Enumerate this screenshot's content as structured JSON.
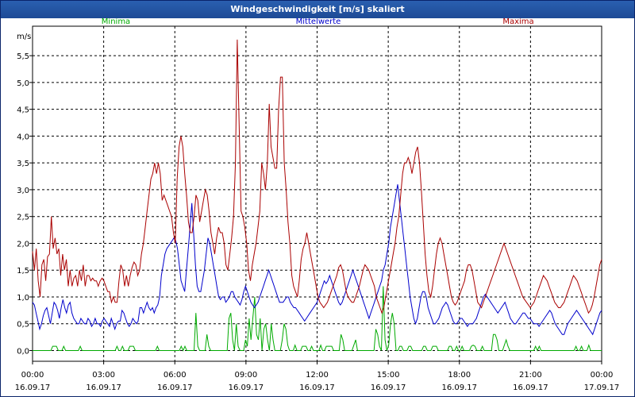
{
  "window": {
    "title": "Windgeschwindigkeit [m/s] skaliert"
  },
  "colors": {
    "minima": "#00aa00",
    "mittelwerte": "#0000cc",
    "maxima": "#aa0000",
    "grid": "#000000"
  },
  "chart_data": {
    "type": "line",
    "title": "Windgeschwindigkeit [m/s] skaliert",
    "ylabel": "m/s",
    "ylim": [
      -0.2,
      6.05
    ],
    "xlim": [
      0,
      24
    ],
    "grid": true,
    "yticks": [
      "0,0",
      "0,5",
      "1,0",
      "1,5",
      "2,0",
      "2,5",
      "3,0",
      "3,5",
      "4,0",
      "4,5",
      "5,0",
      "5,5"
    ],
    "ytick_values": [
      0,
      0.5,
      1,
      1.5,
      2,
      2.5,
      3,
      3.5,
      4,
      4.5,
      5,
      5.5
    ],
    "xticks": [
      {
        "time": "00:00",
        "date": "16.09.17"
      },
      {
        "time": "03:00",
        "date": "16.09.17"
      },
      {
        "time": "06:00",
        "date": "16.09.17"
      },
      {
        "time": "09:00",
        "date": "16.09.17"
      },
      {
        "time": "12:00",
        "date": "16.09.17"
      },
      {
        "time": "15:00",
        "date": "16.09.17"
      },
      {
        "time": "18:00",
        "date": "16.09.17"
      },
      {
        "time": "21:00",
        "date": "16.09.17"
      },
      {
        "time": "00:00",
        "date": "17.09.17"
      }
    ],
    "x_hours_step": 0.1667,
    "series": [
      {
        "name": "Minima",
        "color": "#00aa00",
        "values": [
          0,
          0,
          0,
          0,
          0,
          0,
          0,
          0,
          0,
          0,
          0,
          0.08,
          0.08,
          0.08,
          0,
          0,
          0,
          0.08,
          0,
          0,
          0,
          0,
          0,
          0,
          0,
          0,
          0.08,
          0,
          0,
          0,
          0,
          0,
          0,
          0,
          0,
          0,
          0,
          0,
          0,
          0,
          0,
          0,
          0,
          0,
          0,
          0,
          0.08,
          0,
          0,
          0.08,
          0,
          0,
          0,
          0.08,
          0.08,
          0.08,
          0,
          0,
          0,
          0,
          0,
          0,
          0,
          0,
          0,
          0,
          0,
          0,
          0.08,
          0,
          0,
          0,
          0,
          0,
          0,
          0,
          0,
          0,
          0,
          0,
          0,
          0.08,
          0,
          0.08,
          0,
          0,
          0,
          0,
          0,
          0.7,
          0.08,
          0,
          0,
          0,
          0,
          0.3,
          0.08,
          0,
          0,
          0,
          0,
          0,
          0,
          0,
          0,
          0,
          0,
          0.6,
          0.7,
          0.2,
          0,
          0.5,
          0.08,
          0,
          0,
          0,
          0.2,
          0.08,
          0.6,
          0.2,
          0.6,
          1.0,
          0.3,
          0.2,
          0.6,
          0,
          0.4,
          0.5,
          0.2,
          0,
          0.5,
          0.2,
          0,
          0,
          0,
          0,
          0.2,
          0.5,
          0.4,
          0.1,
          0,
          0,
          0,
          0.1,
          0,
          0,
          0,
          0.08,
          0.08,
          0.08,
          0,
          0,
          0.08,
          0,
          0,
          0,
          0,
          0.1,
          0,
          0,
          0.08,
          0.08,
          0.08,
          0.08,
          0,
          0,
          0,
          0,
          0.3,
          0.2,
          0,
          0,
          0,
          0,
          0,
          0.1,
          0.2,
          0,
          0,
          0,
          0,
          0,
          0,
          0,
          0,
          0,
          0,
          0.4,
          0.3,
          0.08,
          0,
          1.2,
          0.2,
          0,
          0.1,
          0.5,
          0.7,
          0.5,
          0,
          0,
          0.08,
          0.08,
          0,
          0,
          0,
          0.08,
          0.08,
          0,
          0,
          0,
          0,
          0,
          0,
          0.08,
          0.08,
          0,
          0,
          0,
          0.08,
          0.08,
          0.08,
          0,
          0,
          0,
          0,
          0,
          0,
          0.08,
          0.08,
          0,
          0,
          0.08,
          0,
          0,
          0.08,
          0,
          0,
          0,
          0,
          0.08,
          0.1,
          0.08,
          0,
          0,
          0,
          0.08,
          0,
          0,
          0,
          0,
          0,
          0.3,
          0.3,
          0.2,
          0,
          0,
          0,
          0.1,
          0.2,
          0.08,
          0,
          0,
          0,
          0,
          0,
          0,
          0,
          0,
          0,
          0,
          0,
          0,
          0,
          0,
          0.08,
          0,
          0.08,
          0,
          0,
          0,
          0,
          0,
          0,
          0,
          0,
          0,
          0,
          0,
          0,
          0,
          0,
          0,
          0,
          0,
          0,
          0,
          0.08,
          0,
          0,
          0.08,
          0,
          0,
          0,
          0.1,
          0,
          0,
          0,
          0,
          0,
          0,
          0
        ]
      },
      {
        "name": "Mittelwerte",
        "color": "#0000cc",
        "values": [
          0.9,
          0.85,
          0.7,
          0.55,
          0.4,
          0.5,
          0.65,
          0.75,
          0.8,
          0.65,
          0.5,
          0.7,
          0.9,
          0.85,
          0.75,
          0.6,
          0.8,
          0.95,
          0.8,
          0.7,
          0.85,
          0.9,
          0.7,
          0.6,
          0.55,
          0.5,
          0.5,
          0.6,
          0.55,
          0.5,
          0.5,
          0.6,
          0.55,
          0.45,
          0.5,
          0.6,
          0.5,
          0.5,
          0.45,
          0.55,
          0.6,
          0.55,
          0.5,
          0.45,
          0.6,
          0.5,
          0.4,
          0.5,
          0.55,
          0.55,
          0.75,
          0.7,
          0.6,
          0.5,
          0.45,
          0.5,
          0.6,
          0.55,
          0.5,
          0.55,
          0.8,
          0.8,
          0.7,
          0.8,
          0.9,
          0.8,
          0.75,
          0.8,
          0.7,
          0.8,
          0.85,
          1.0,
          1.4,
          1.6,
          1.8,
          1.9,
          1.95,
          2.0,
          2.05,
          2.1,
          2.05,
          1.9,
          1.6,
          1.3,
          1.2,
          1.1,
          1.5,
          1.9,
          2.3,
          2.75,
          2.2,
          1.6,
          1.2,
          1.1,
          1.1,
          1.3,
          1.5,
          1.8,
          2.1,
          2.0,
          1.8,
          1.6,
          1.4,
          1.2,
          1.0,
          0.95,
          1.0,
          1.0,
          0.9,
          0.95,
          1.0,
          1.1,
          1.1,
          1.0,
          0.95,
          0.9,
          0.85,
          0.95,
          1.1,
          1.2,
          1.1,
          1.0,
          0.9,
          0.85,
          0.8,
          0.85,
          0.9,
          1.0,
          1.1,
          1.2,
          1.3,
          1.4,
          1.5,
          1.4,
          1.3,
          1.2,
          1.1,
          1.0,
          0.9,
          0.9,
          0.9,
          0.95,
          1.0,
          1.0,
          0.9,
          0.85,
          0.8,
          0.8,
          0.75,
          0.7,
          0.65,
          0.6,
          0.55,
          0.6,
          0.65,
          0.7,
          0.75,
          0.8,
          0.85,
          0.9,
          1.0,
          1.1,
          1.2,
          1.3,
          1.25,
          1.3,
          1.4,
          1.3,
          1.2,
          1.1,
          1.0,
          0.9,
          0.85,
          0.9,
          1.0,
          1.1,
          1.2,
          1.3,
          1.4,
          1.5,
          1.4,
          1.3,
          1.2,
          1.1,
          1.0,
          0.9,
          0.8,
          0.7,
          0.6,
          0.7,
          0.8,
          0.9,
          1.0,
          1.1,
          1.2,
          1.3,
          1.5,
          1.6,
          1.8,
          2.0,
          2.3,
          2.5,
          2.7,
          2.9,
          3.1,
          2.8,
          2.5,
          2.2,
          1.9,
          1.6,
          1.3,
          1.0,
          0.8,
          0.6,
          0.5,
          0.6,
          0.8,
          1.0,
          1.1,
          1.1,
          1.0,
          0.8,
          0.7,
          0.6,
          0.5,
          0.5,
          0.55,
          0.6,
          0.7,
          0.8,
          0.85,
          0.9,
          0.85,
          0.75,
          0.65,
          0.55,
          0.5,
          0.5,
          0.55,
          0.6,
          0.6,
          0.55,
          0.5,
          0.45,
          0.5,
          0.5,
          0.5,
          0.55,
          0.6,
          0.7,
          0.8,
          0.9,
          1.0,
          1.05,
          1.0,
          0.95,
          0.9,
          0.85,
          0.8,
          0.75,
          0.7,
          0.75,
          0.8,
          0.85,
          0.9,
          0.8,
          0.7,
          0.6,
          0.55,
          0.5,
          0.5,
          0.55,
          0.6,
          0.65,
          0.7,
          0.7,
          0.65,
          0.6,
          0.6,
          0.55,
          0.5,
          0.5,
          0.5,
          0.45,
          0.5,
          0.55,
          0.6,
          0.65,
          0.7,
          0.75,
          0.7,
          0.6,
          0.5,
          0.45,
          0.4,
          0.35,
          0.3,
          0.3,
          0.4,
          0.5,
          0.55,
          0.6,
          0.65,
          0.7,
          0.75,
          0.7,
          0.65,
          0.6,
          0.55,
          0.5,
          0.45,
          0.4,
          0.35,
          0.3,
          0.4,
          0.5,
          0.6,
          0.7,
          0.75
        ]
      },
      {
        "name": "Maxima",
        "color": "#aa0000",
        "values": [
          1.85,
          1.5,
          1.9,
          1.3,
          1.0,
          1.6,
          1.7,
          1.3,
          1.75,
          1.8,
          2.5,
          1.9,
          2.1,
          1.8,
          1.9,
          1.4,
          1.8,
          1.5,
          1.7,
          1.2,
          1.5,
          1.2,
          1.35,
          1.4,
          1.2,
          1.5,
          1.3,
          1.6,
          1.2,
          1.4,
          1.4,
          1.3,
          1.35,
          1.3,
          1.3,
          1.2,
          1.3,
          1.35,
          1.3,
          1.2,
          1.1,
          1.1,
          0.9,
          1.0,
          0.9,
          0.9,
          1.3,
          1.6,
          1.5,
          1.2,
          1.4,
          1.2,
          1.4,
          1.55,
          1.65,
          1.6,
          1.4,
          1.5,
          1.8,
          2.0,
          2.3,
          2.6,
          2.9,
          3.2,
          3.3,
          3.5,
          3.3,
          3.5,
          3.3,
          2.8,
          2.9,
          2.8,
          2.7,
          2.6,
          2.5,
          2.2,
          2.0,
          3.2,
          3.8,
          4.0,
          3.8,
          3.3,
          2.9,
          2.4,
          2.2,
          2.2,
          2.5,
          2.9,
          2.8,
          2.4,
          2.6,
          2.8,
          3.0,
          2.9,
          2.6,
          2.2,
          2.0,
          1.8,
          2.1,
          2.3,
          2.2,
          2.2,
          2.0,
          1.6,
          1.5,
          1.8,
          2.1,
          2.5,
          3.5,
          5.8,
          4.2,
          2.6,
          2.5,
          2.3,
          2.0,
          1.5,
          1.3,
          1.6,
          1.8,
          2.0,
          2.3,
          2.6,
          3.5,
          3.3,
          3.0,
          3.5,
          4.6,
          3.8,
          3.6,
          3.4,
          3.4,
          4.5,
          5.1,
          5.1,
          3.5,
          3.0,
          2.4,
          2.0,
          1.4,
          1.2,
          1.1,
          1.0,
          1.3,
          1.7,
          1.9,
          2.0,
          2.2,
          2.0,
          1.8,
          1.6,
          1.4,
          1.2,
          1.0,
          0.9,
          0.85,
          0.8,
          0.85,
          0.9,
          1.0,
          1.1,
          1.2,
          1.3,
          1.4,
          1.55,
          1.6,
          1.5,
          1.3,
          1.1,
          1.0,
          0.95,
          0.9,
          0.9,
          1.0,
          1.1,
          1.2,
          1.35,
          1.5,
          1.6,
          1.55,
          1.5,
          1.4,
          1.3,
          1.2,
          1.0,
          0.9,
          0.8,
          0.7,
          0.8,
          1.0,
          1.2,
          1.4,
          1.6,
          1.8,
          2.0,
          2.3,
          2.5,
          2.9,
          3.3,
          3.5,
          3.5,
          3.6,
          3.5,
          3.3,
          3.5,
          3.7,
          3.8,
          3.5,
          3.0,
          2.4,
          1.8,
          1.4,
          1.1,
          1.0,
          1.2,
          1.5,
          1.8,
          2.0,
          2.1,
          2.0,
          1.8,
          1.6,
          1.4,
          1.2,
          1.0,
          0.9,
          0.85,
          0.9,
          1.0,
          1.1,
          1.2,
          1.3,
          1.5,
          1.6,
          1.6,
          1.5,
          1.3,
          1.1,
          0.9,
          0.85,
          0.8,
          0.9,
          1.0,
          1.1,
          1.2,
          1.3,
          1.4,
          1.5,
          1.6,
          1.7,
          1.8,
          1.9,
          2.0,
          1.9,
          1.8,
          1.7,
          1.6,
          1.5,
          1.4,
          1.3,
          1.2,
          1.1,
          1.0,
          0.95,
          0.9,
          0.85,
          0.8,
          0.85,
          0.9,
          1.0,
          1.1,
          1.2,
          1.3,
          1.4,
          1.35,
          1.3,
          1.2,
          1.1,
          1.0,
          0.9,
          0.85,
          0.8,
          0.8,
          0.85,
          0.9,
          1.0,
          1.1,
          1.2,
          1.3,
          1.4,
          1.35,
          1.3,
          1.2,
          1.1,
          1.0,
          0.9,
          0.8,
          0.7,
          0.75,
          0.85,
          1.0,
          1.2,
          1.4,
          1.6,
          1.7
        ]
      }
    ],
    "legend": [
      "Minima",
      "Mittelwerte",
      "Maxima"
    ]
  }
}
